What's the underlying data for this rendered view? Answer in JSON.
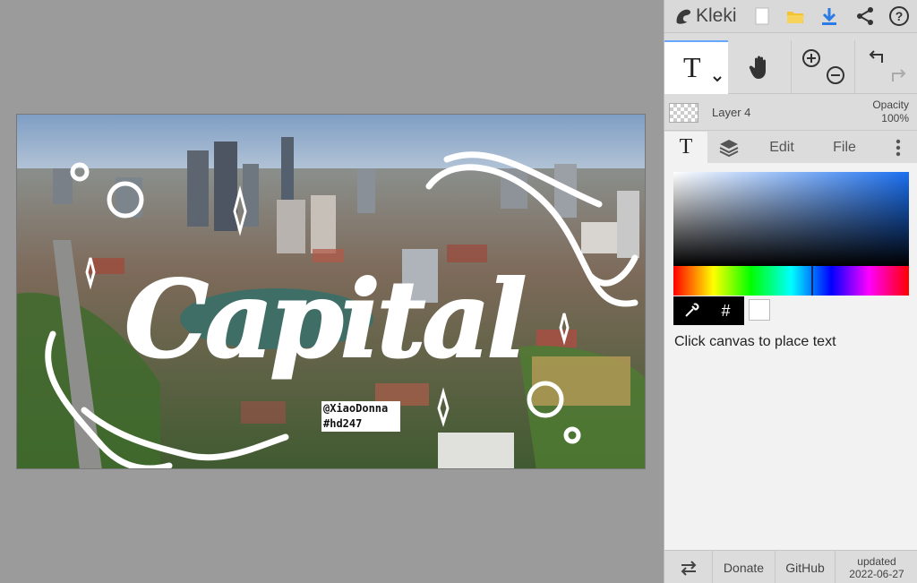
{
  "app": {
    "name": "Kleki"
  },
  "topbar": {
    "icons": [
      "new-image-icon",
      "open-folder-icon",
      "download-icon",
      "share-icon",
      "help-icon"
    ]
  },
  "tools": {
    "text_tool_glyph": "T",
    "hand_tool": "hand-icon",
    "zoom_in": "zoom-in-icon",
    "zoom_out": "zoom-out-icon",
    "undo": "undo-icon",
    "redo": "redo-icon"
  },
  "layer": {
    "name": "Layer 4",
    "opacity_label": "Opacity",
    "opacity_value": "100%"
  },
  "tabs": {
    "text_tab": "T",
    "edit": "Edit",
    "file": "File"
  },
  "color_picker": {
    "hex_button": "#",
    "current_color": "#ffffff",
    "accent": "#66a7ff"
  },
  "hint": "Click canvas to place text",
  "bottombar": {
    "donate": "Donate",
    "github": "GitHub",
    "updated_label": "updated",
    "updated_date": "2022-06-27"
  },
  "canvas": {
    "title_text": "Capital",
    "credit_line1": "@XiaoDonna",
    "credit_line2": "#hd247"
  }
}
